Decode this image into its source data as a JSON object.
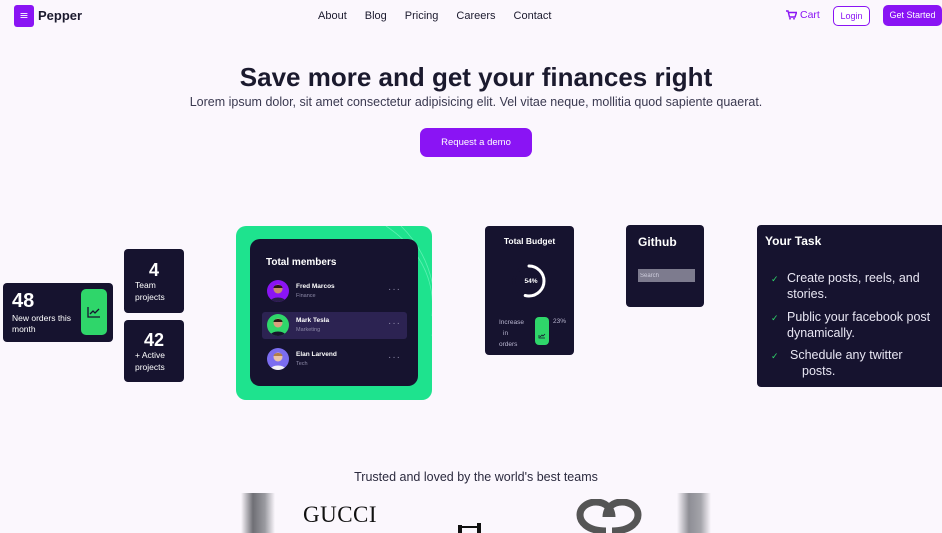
{
  "nav": {
    "logo_icon": "menu-icon",
    "brand": "Pepper",
    "links": [
      "About",
      "Blog",
      "Pricing",
      "Careers",
      "Contact"
    ],
    "cart": "Cart",
    "login": "Login",
    "get_started": "Get Started"
  },
  "hero": {
    "title": "Save more and get your finances right",
    "subtitle": "Lorem ipsum dolor, sit amet consectetur adipisicing elit. Vel vitae neque, mollitia quod sapiente quaerat.",
    "cta": "Request a demo"
  },
  "stats": {
    "orders": {
      "value": "48",
      "label": "New orders this month",
      "icon": "trending-up-icon"
    },
    "team": {
      "value": "4",
      "label1": "Team",
      "label2": "projects"
    },
    "active": {
      "value": "42",
      "label1": "+ Active",
      "label2": "projects"
    }
  },
  "members": {
    "title": "Total members",
    "rows": [
      {
        "name": "Fred Marcos",
        "role": "Finance"
      },
      {
        "name": "Mark Tesla",
        "role": "Marketing"
      },
      {
        "name": "Elan Larvend",
        "role": "Tech"
      }
    ],
    "dots": "···"
  },
  "budget": {
    "title": "Total Budget",
    "percent": "54%",
    "percent_value": 0.54,
    "increase_label1": "Increase",
    "increase_label2": "in",
    "increase_label3": "orders",
    "increase_value": "23%"
  },
  "github": {
    "title": "Github",
    "search_placeholder": "Search"
  },
  "task": {
    "title": "Your Task",
    "items": [
      {
        "line1": "Create posts, reels, and",
        "line2": "stories."
      },
      {
        "line1": "Public your facebook post",
        "line2": "dynamically."
      },
      {
        "line1": "Schedule any twitter",
        "line2": "posts."
      }
    ]
  },
  "trusted": {
    "title": "Trusted and loved by the world's best teams",
    "logo_gucci": "GUCCI"
  },
  "colors": {
    "brand": "#8a14f4",
    "dark": "#16132f",
    "green": "#2fd66a",
    "mint": "#1ee38e"
  }
}
